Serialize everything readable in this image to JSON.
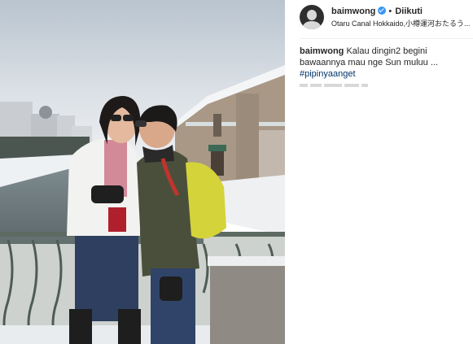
{
  "post": {
    "author": {
      "username": "baimwong",
      "verified": true,
      "follow_status": "Diikuti",
      "separator": "•",
      "avatar_icon": "profile-avatar",
      "verified_icon": "verified-badge-icon"
    },
    "location": "Otaru Canal Hokkaido,小樽運河おたるう...",
    "caption": {
      "username": "baimwong",
      "text": "Kalau dingin2 begini bawaannya mau nge Sun muluu ...",
      "hashtag": "#pipinyaanget"
    },
    "colors": {
      "text": "#262626",
      "hashtag": "#003569",
      "verified": "#3897f0",
      "divider": "#efefef"
    }
  }
}
